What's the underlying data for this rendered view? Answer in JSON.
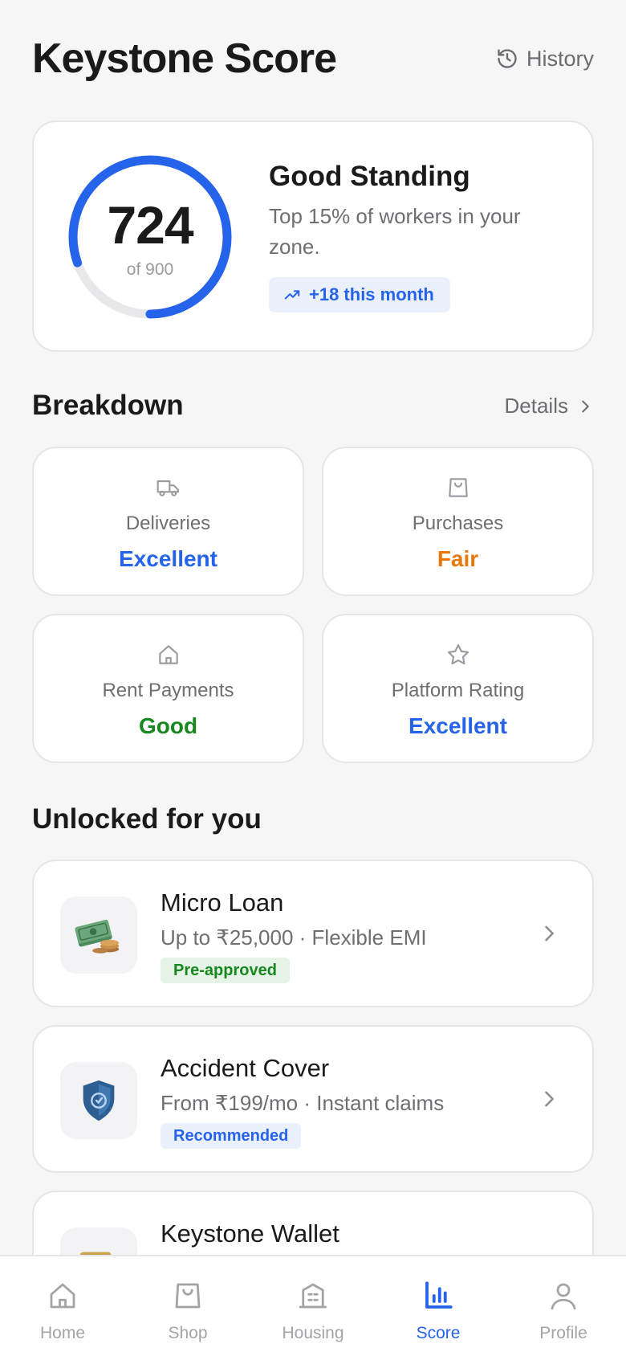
{
  "header": {
    "title": "Keystone Score",
    "history_label": "History"
  },
  "score": {
    "value": "724",
    "max_label": "of 900",
    "progress_fraction": 0.804,
    "standing": "Good Standing",
    "description": "Top 15% of workers in your zone.",
    "trend": "+18 this month"
  },
  "breakdown": {
    "title": "Breakdown",
    "details_label": "Details",
    "items": [
      {
        "label": "Deliveries",
        "value": "Excellent",
        "icon": "truck-icon",
        "color": "#2563eb"
      },
      {
        "label": "Purchases",
        "value": "Fair",
        "icon": "shopping-bag-icon",
        "color": "#e8780c"
      },
      {
        "label": "Rent Payments",
        "value": "Good",
        "icon": "home-icon",
        "color": "#16881f"
      },
      {
        "label": "Platform Rating",
        "value": "Excellent",
        "icon": "star-icon",
        "color": "#2563eb"
      }
    ]
  },
  "unlocked": {
    "title": "Unlocked for you",
    "offers": [
      {
        "title": "Micro Loan",
        "desc": "Up to ₹25,000 · Flexible EMI",
        "badge": "Pre-approved",
        "icon": "money-icon"
      },
      {
        "title": "Accident Cover",
        "desc": "From ₹199/mo · Instant claims",
        "badge": "Recommended",
        "icon": "shield-icon"
      },
      {
        "title": "Keystone Wallet",
        "icon": "wallet-icon"
      }
    ]
  },
  "nav": {
    "items": [
      {
        "label": "Home",
        "icon": "home-icon"
      },
      {
        "label": "Shop",
        "icon": "shopping-bag-icon"
      },
      {
        "label": "Housing",
        "icon": "building-icon"
      },
      {
        "label": "Score",
        "icon": "bar-chart-icon",
        "active": true
      },
      {
        "label": "Profile",
        "icon": "user-icon"
      }
    ]
  },
  "colors": {
    "accent": "#2563eb",
    "good": "#16881f",
    "fair": "#e8780c"
  }
}
